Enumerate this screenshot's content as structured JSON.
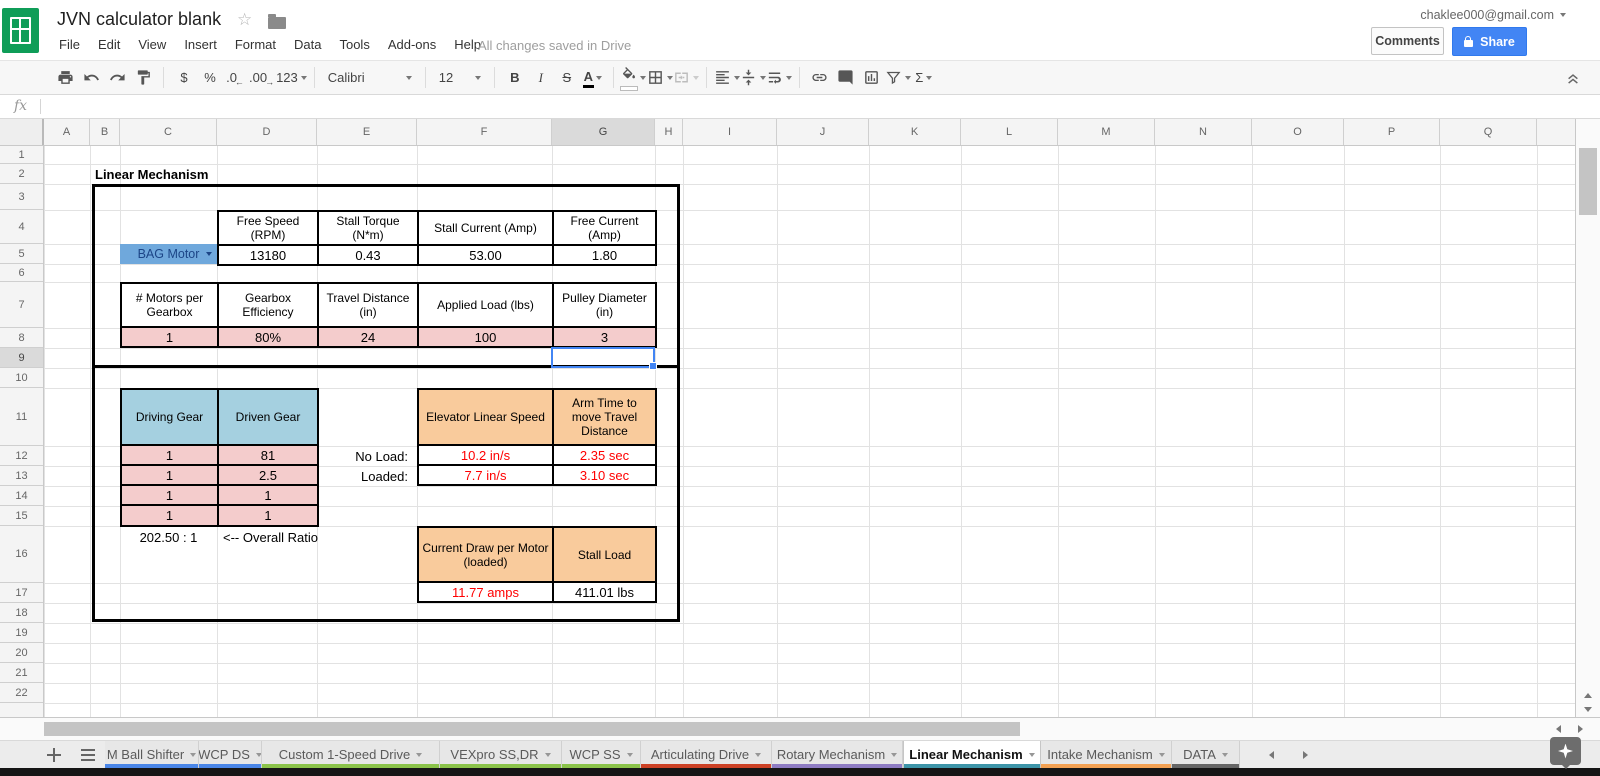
{
  "header": {
    "title": "JVN calculator blank",
    "menus": [
      "File",
      "Edit",
      "View",
      "Insert",
      "Format",
      "Data",
      "Tools",
      "Add-ons",
      "Help"
    ],
    "save_status": "All changes saved in Drive",
    "account_email": "chaklee000@gmail.com",
    "comments_label": "Comments",
    "share_label": "Share"
  },
  "toolbar": {
    "currency": "$",
    "percent": "%",
    "decrease_decimal": ".0",
    "increase_decimal": ".00",
    "more_formats": "123",
    "font_name": "Calibri",
    "font_size": "12",
    "bold": "B",
    "italic": "I",
    "strikethrough": "S",
    "text_color": "A",
    "sum": "Σ"
  },
  "formula_bar": {
    "fx_label": "fx",
    "value": ""
  },
  "grid": {
    "col_letters": [
      "A",
      "B",
      "C",
      "D",
      "E",
      "F",
      "G",
      "H",
      "I",
      "J",
      "K",
      "L",
      "M",
      "N",
      "O",
      "P",
      "Q"
    ],
    "row_numbers": [
      "1",
      "2",
      "3",
      "4",
      "5",
      "6",
      "7",
      "8",
      "9",
      "10",
      "11",
      "12",
      "13",
      "14",
      "15",
      "16",
      "17",
      "18",
      "19",
      "20",
      "21",
      "22"
    ],
    "selected_column": "G",
    "selected_row": "9"
  },
  "sheet": {
    "section_title": "Linear Mechanism",
    "motor_selector": "BAG Motor",
    "motor_table": {
      "headers": [
        "Free Speed (RPM)",
        "Stall Torque (N*m)",
        "Stall Current (Amp)",
        "Free Current (Amp)"
      ],
      "values": [
        "13180",
        "0.43",
        "53.00",
        "1.80"
      ]
    },
    "params_table": {
      "headers": [
        "# Motors per Gearbox",
        "Gearbox Efficiency",
        "Travel Distance (in)",
        "Applied Load (lbs)",
        "Pulley Diameter (in)"
      ],
      "values": [
        "1",
        "80%",
        "24",
        "100",
        "3"
      ]
    },
    "gear_table": {
      "headers": [
        "Driving Gear",
        "Driven Gear"
      ],
      "rows": [
        {
          "driving": "1",
          "driven": "81"
        },
        {
          "driving": "1",
          "driven": "2.5"
        },
        {
          "driving": "1",
          "driven": "1"
        },
        {
          "driving": "1",
          "driven": "1"
        }
      ]
    },
    "overall_ratio": "202.50 : 1",
    "overall_ratio_label": "<-- Overall Ratio",
    "speed_table": {
      "headers": [
        "Elevator Linear Speed",
        "Arm Time to move Travel Distance"
      ],
      "rows": [
        {
          "label": "No Load:",
          "speed": "10.2 in/s",
          "time": "2.35 sec"
        },
        {
          "label": "Loaded:",
          "speed": "7.7 in/s",
          "time": "3.10 sec"
        }
      ]
    },
    "load_table": {
      "headers": [
        "Current Draw per Motor (loaded)",
        "Stall Load"
      ],
      "values": [
        "11.77 amps",
        "411.01 lbs"
      ]
    }
  },
  "tabs": {
    "items": [
      {
        "label": "M Ball Shifter",
        "color": "#4a86e8"
      },
      {
        "label": "WCP DS",
        "color": "#4a86e8"
      },
      {
        "label": "Custom 1-Speed Drive",
        "color": "#8bc34a"
      },
      {
        "label": "VEXpro SS,DR",
        "color": "#8bc34a"
      },
      {
        "label": "WCP SS",
        "color": "#8bc34a"
      },
      {
        "label": "Articulating Drive",
        "color": "#cc4125"
      },
      {
        "label": "Rotary Mechanism",
        "color": "#8e7cc3"
      },
      {
        "label": "Linear Mechanism",
        "color": "#3d95a9",
        "active": true
      },
      {
        "label": "Intake Mechanism",
        "color": "#f3a153"
      },
      {
        "label": "DATA",
        "color": "#666666"
      }
    ]
  },
  "colors": {
    "logo_green": "#0f9d58",
    "share_blue": "#4285f4",
    "selection_blue": "#4285f4",
    "motor_cell_fill": "#6fa8dc",
    "motor_cell_text": "#1c4587",
    "input_pink": "#f4cccc",
    "gear_header_blue": "#a5d0e0",
    "result_header_peach": "#f9cb9c",
    "result_red_text": "#ff0000"
  }
}
